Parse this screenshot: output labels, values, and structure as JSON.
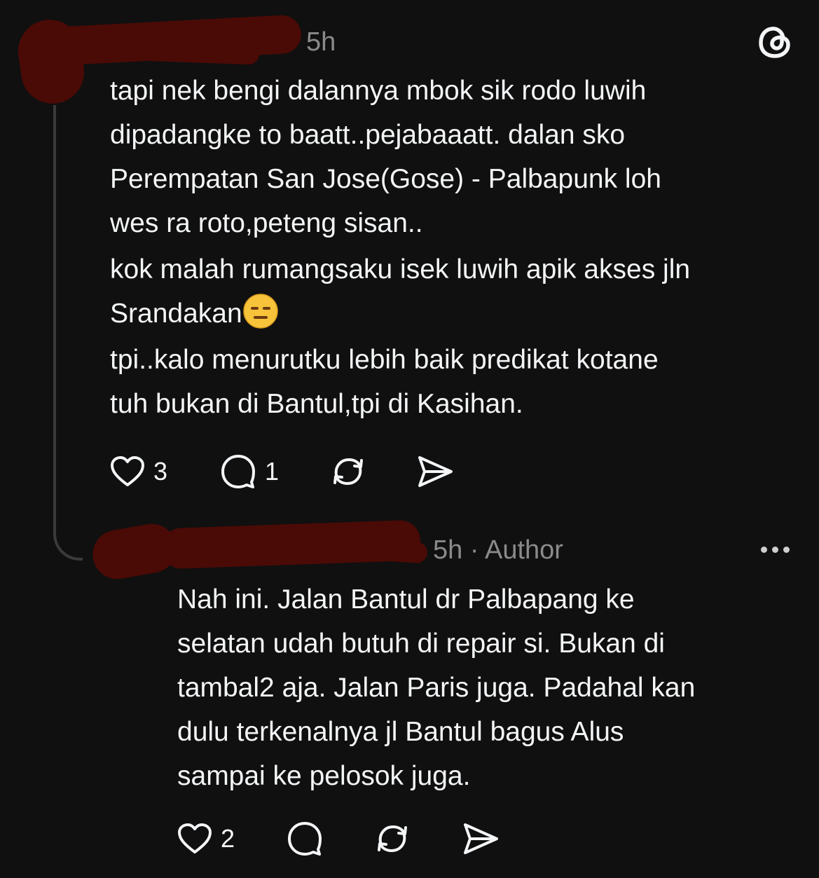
{
  "top_post": {
    "timestamp": "5h",
    "paragraphs": [
      "tapi nek bengi dalannya mbok sik rodo luwih\ndipadangke to baatt..pejabaaatt. dalan sko\nPerempatan San Jose(Gose) - Palbapunk loh\nwes ra roto,peteng sisan..",
      "kok malah rumangsaku isek luwih apik akses jln",
      "tpi..kalo menurutku lebih baik predikat kotane\ntuh bukan di Bantul,tpi di Kasihan."
    ],
    "paragraph_2_line_2": "Srandakan",
    "emoji": "expressionless-face-emoji",
    "like_count": "3",
    "reply_count": "1"
  },
  "reply_post": {
    "timestamp": "5h",
    "separator": "·",
    "author_badge": "Author",
    "paragraphs": [
      "Nah ini. Jalan Bantul dr Palbapang ke\nselatan udah butuh di repair si. Bukan di\ntambal2 aja. Jalan Paris juga. Padahal kan\ndulu terkenalnya jl Bantul bagus Alus\nsampai ke pelosok juga."
    ],
    "like_count": "2"
  },
  "icons": {
    "app_logo": "threads-logo-icon",
    "like": "heart-icon",
    "reply": "comment-bubble-icon",
    "repost": "repost-icon",
    "share": "send-icon",
    "more": "more-options-icon"
  },
  "colors": {
    "background": "#101010",
    "text": "#f3f5f7",
    "muted": "#8a8a8a",
    "thread_line": "#3a3a3a",
    "redaction": "#4a0a06"
  }
}
